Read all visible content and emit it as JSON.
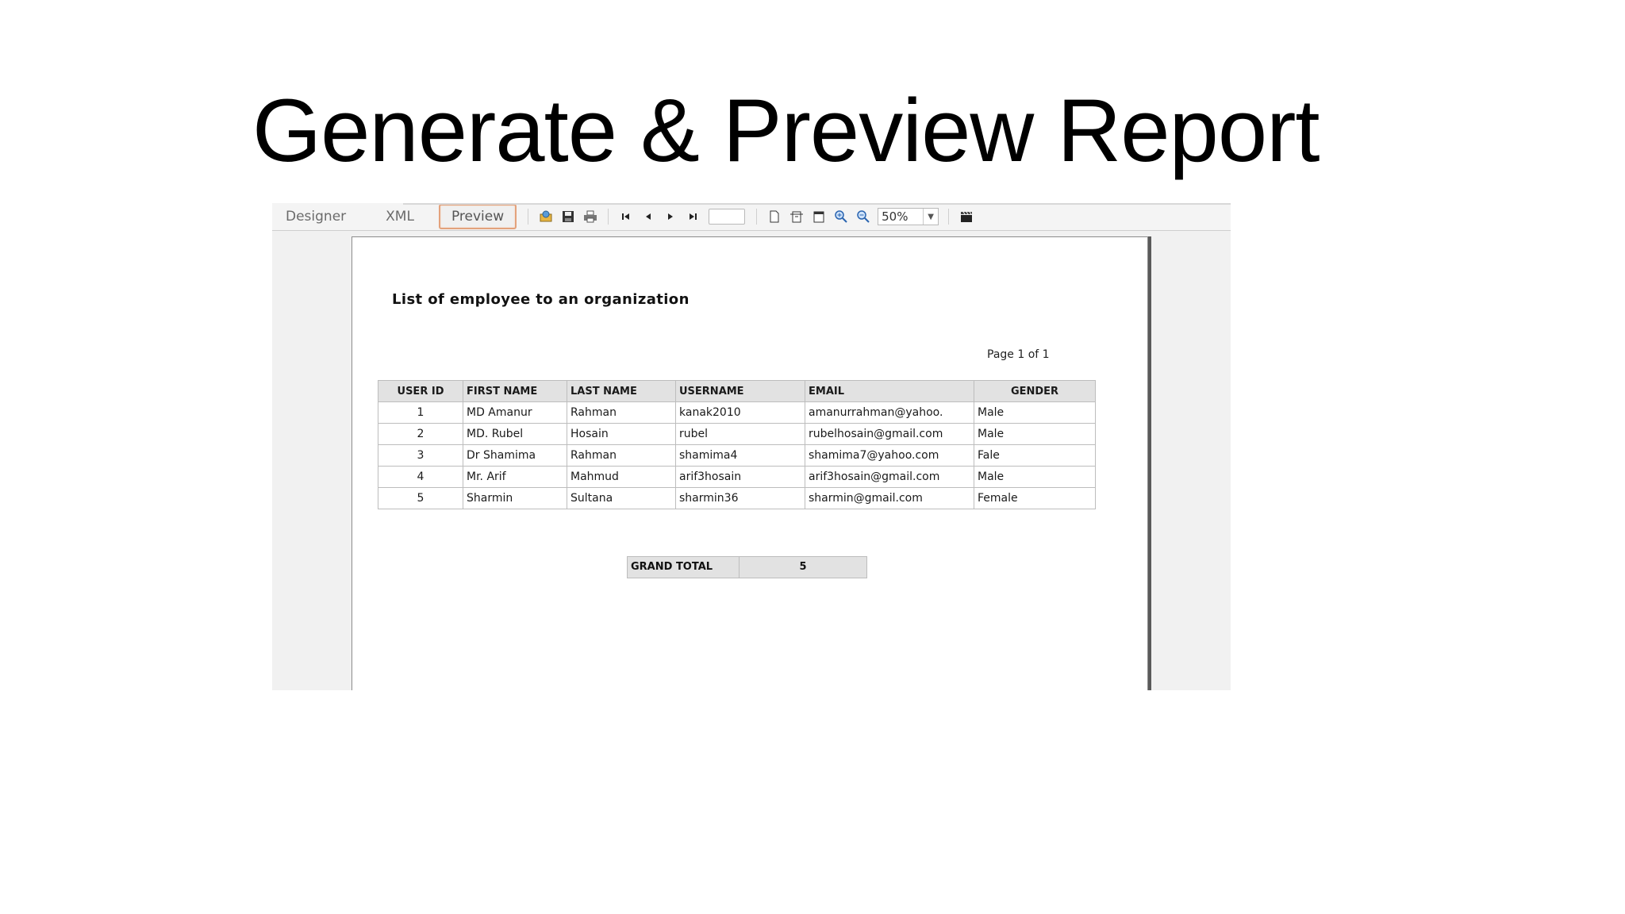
{
  "slide": {
    "title": "Generate & Preview Report"
  },
  "tabs": [
    {
      "label": "Designer"
    },
    {
      "label": "XML"
    },
    {
      "label": "Preview"
    }
  ],
  "toolbar": {
    "icons": [
      "open-icon",
      "save-icon",
      "print-icon",
      "first-page-icon",
      "previous-page-icon",
      "next-page-icon",
      "last-page-icon",
      "actual-size-icon",
      "fit-width-icon",
      "fit-page-icon",
      "zoom-in-icon",
      "zoom-out-icon",
      "clapperboard-icon"
    ],
    "page_value": "",
    "zoom": "50%"
  },
  "report": {
    "title": "List of employee to an organization",
    "page_indicator": "Page 1 of 1",
    "columns": [
      "USER ID",
      "FIRST NAME",
      "LAST NAME",
      "USERNAME",
      "EMAIL",
      "GENDER"
    ],
    "rows": [
      [
        "1",
        "MD Amanur",
        "Rahman",
        "kanak2010",
        "amanurrahman@yahoo.",
        "Male"
      ],
      [
        "2",
        "MD. Rubel",
        "Hosain",
        "rubel",
        "rubelhosain@gmail.com",
        "Male"
      ],
      [
        "3",
        "Dr Shamima",
        "Rahman",
        "shamima4",
        "shamima7@yahoo.com",
        "Fale"
      ],
      [
        "4",
        "Mr. Arif",
        "Mahmud",
        "arif3hosain",
        "arif3hosain@gmail.com",
        "Male"
      ],
      [
        "5",
        "Sharmin",
        "Sultana",
        "sharmin36",
        "sharmin@gmail.com",
        "Female"
      ]
    ],
    "grand_total_label": "GRAND TOTAL",
    "grand_total_value": "5"
  }
}
